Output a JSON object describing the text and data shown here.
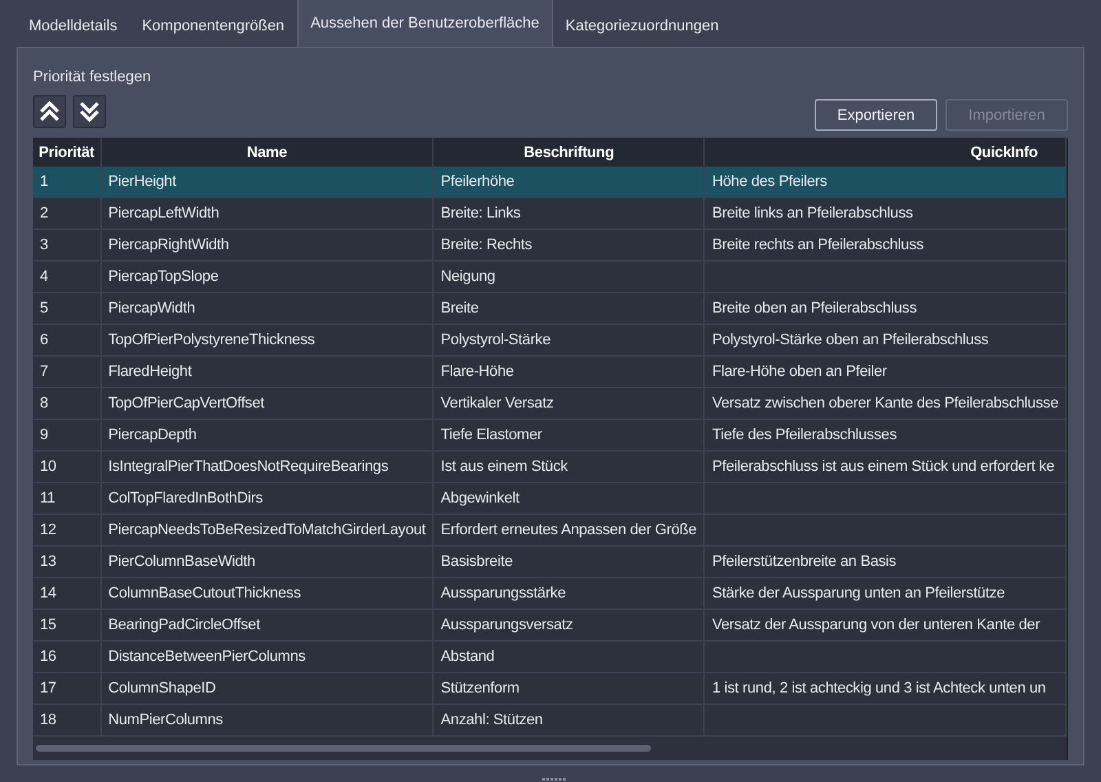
{
  "tabs": [
    {
      "label": "Modelldetails",
      "selected": false
    },
    {
      "label": "Komponentengrößen",
      "selected": false
    },
    {
      "label": "Aussehen der Benutzeroberfläche",
      "selected": true
    },
    {
      "label": "Kategoriezuordnungen",
      "selected": false
    }
  ],
  "priority_label": "Priorität festlegen",
  "buttons": [
    {
      "label": "Exportieren",
      "disabled": false
    },
    {
      "label": "Importieren",
      "disabled": true
    }
  ],
  "table": {
    "columns": [
      "Priorität",
      "Name",
      "Beschriftung",
      "QuickInfo"
    ],
    "rows": [
      {
        "cells": [
          "1",
          "PierHeight",
          "Pfeilerhöhe",
          "Höhe des Pfeilers"
        ],
        "selected": true
      },
      {
        "cells": [
          "2",
          "PiercapLeftWidth",
          "Breite: Links",
          "Breite links an Pfeilerabschluss"
        ],
        "selected": false
      },
      {
        "cells": [
          "3",
          "PiercapRightWidth",
          "Breite: Rechts",
          "Breite rechts an Pfeilerabschluss"
        ],
        "selected": false
      },
      {
        "cells": [
          "4",
          "PiercapTopSlope",
          "Neigung",
          ""
        ],
        "selected": false
      },
      {
        "cells": [
          "5",
          "PiercapWidth",
          "Breite",
          "Breite oben an Pfeilerabschluss"
        ],
        "selected": false
      },
      {
        "cells": [
          "6",
          "TopOfPierPolystyreneThickness",
          "Polystyrol-Stärke",
          "Polystyrol-Stärke oben an Pfeilerabschluss"
        ],
        "selected": false
      },
      {
        "cells": [
          "7",
          "FlaredHeight",
          "Flare-Höhe",
          "Flare-Höhe oben an Pfeiler"
        ],
        "selected": false
      },
      {
        "cells": [
          "8",
          "TopOfPierCapVertOffset",
          "Vertikaler Versatz",
          "Versatz zwischen oberer Kante des Pfeilerabschlusse"
        ],
        "selected": false
      },
      {
        "cells": [
          "9",
          "PiercapDepth",
          "Tiefe Elastomer",
          "Tiefe des Pfeilerabschlusses"
        ],
        "selected": false
      },
      {
        "cells": [
          "10",
          "IsIntegralPierThatDoesNotRequireBearings",
          "Ist aus einem Stück",
          "Pfeilerabschluss ist aus einem Stück und erfordert ke"
        ],
        "selected": false
      },
      {
        "cells": [
          "11",
          "ColTopFlaredInBothDirs",
          "Abgewinkelt",
          ""
        ],
        "selected": false
      },
      {
        "cells": [
          "12",
          "PiercapNeedsToBeResizedToMatchGirderLayout",
          "Erfordert erneutes Anpassen der Größe",
          ""
        ],
        "selected": false
      },
      {
        "cells": [
          "13",
          "PierColumnBaseWidth",
          "Basisbreite",
          "Pfeilerstützenbreite an Basis"
        ],
        "selected": false
      },
      {
        "cells": [
          "14",
          "ColumnBaseCutoutThickness",
          "Aussparungsstärke",
          "Stärke der Aussparung unten an Pfeilerstütze"
        ],
        "selected": false
      },
      {
        "cells": [
          "15",
          "BearingPadCircleOffset",
          "Aussparungsversatz",
          "Versatz der Aussparung von der unteren Kante der"
        ],
        "selected": false
      },
      {
        "cells": [
          "16",
          "DistanceBetweenPierColumns",
          "Abstand",
          ""
        ],
        "selected": false
      },
      {
        "cells": [
          "17",
          "ColumnShapeID",
          "Stützenform",
          "1 ist rund, 2 ist achteckig und 3 ist Achteck unten un"
        ],
        "selected": false
      },
      {
        "cells": [
          "18",
          "NumPierColumns",
          "Anzahl: Stützen",
          ""
        ],
        "selected": false
      }
    ]
  }
}
